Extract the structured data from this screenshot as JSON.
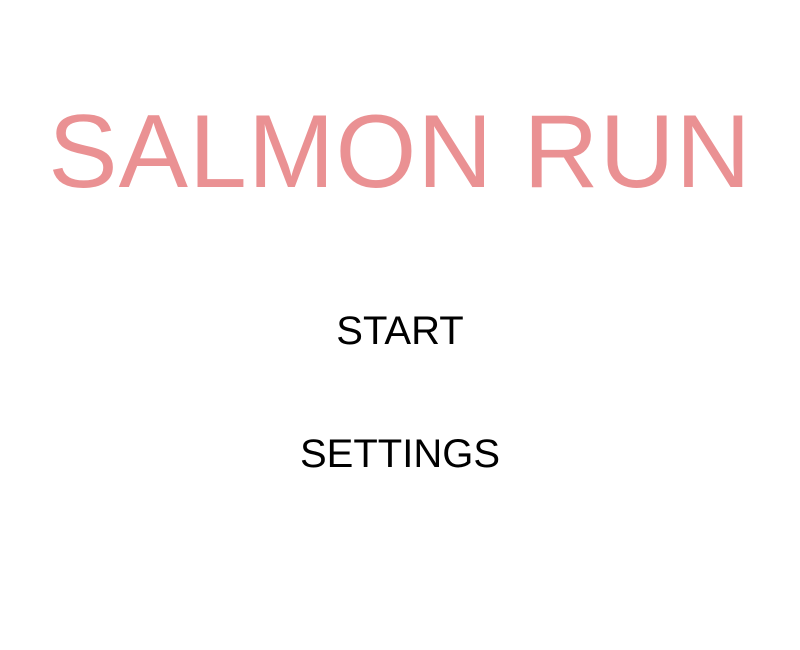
{
  "game": {
    "title": "SALMON RUN",
    "title_color": "#ea9193"
  },
  "menu": {
    "start_label": "START",
    "settings_label": "SETTINGS"
  }
}
